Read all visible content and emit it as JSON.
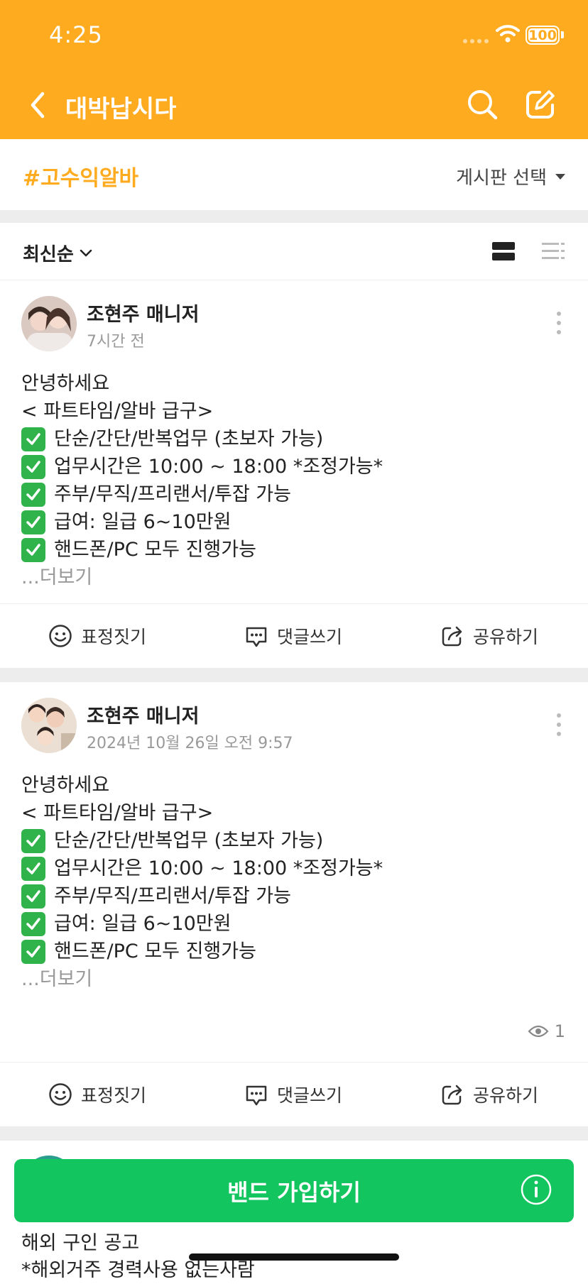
{
  "status_bar": {
    "time": "4:25",
    "battery": "100"
  },
  "header": {
    "title": "대박납시다"
  },
  "board": {
    "hashtag": "#고수익알바",
    "select_label": "게시판 선택"
  },
  "sort": {
    "label": "최신순"
  },
  "posts": [
    {
      "author": "조현주 매니저",
      "time": "7시간 전",
      "lines": [
        "안녕하세요",
        "< 파트타임/알바 급구>",
        "단순/간단/반복업무 (초보자 가능)",
        "업무시간은 10:00 ~ 18:00 *조정가능*",
        "주부/무직/프리랜서/투잡 가능",
        "급여: 일급 6~10만원",
        "핸드폰/PC 모두 진행가능"
      ],
      "more": "...더보기",
      "actions": {
        "react": "표정짓기",
        "comment": "댓글쓰기",
        "share": "공유하기"
      }
    },
    {
      "author": "조현주 매니저",
      "time": "2024년 10월 26일 오전 9:57",
      "lines": [
        "안녕하세요",
        "< 파트타임/알바 급구>",
        "단순/간단/반복업무 (초보자 가능)",
        "업무시간은 10:00 ~ 18:00 *조정가능*",
        "주부/무직/프리랜서/투잡 가능",
        "급여: 일급 6~10만원",
        "핸드폰/PC 모두 진행가능"
      ],
      "more": "...더보기",
      "views": "1",
      "actions": {
        "react": "표정짓기",
        "comment": "댓글쓰기",
        "share": "공유하기"
      }
    }
  ],
  "join_button": {
    "label": "밴드 가입하기"
  },
  "post3_preview": {
    "line1": "해외 구인 공고",
    "line2": "*해외거주 경력사용 없는사람"
  },
  "colors": {
    "brand": "#FFAB1F",
    "join": "#13C55F",
    "check": "#2FB34A"
  }
}
